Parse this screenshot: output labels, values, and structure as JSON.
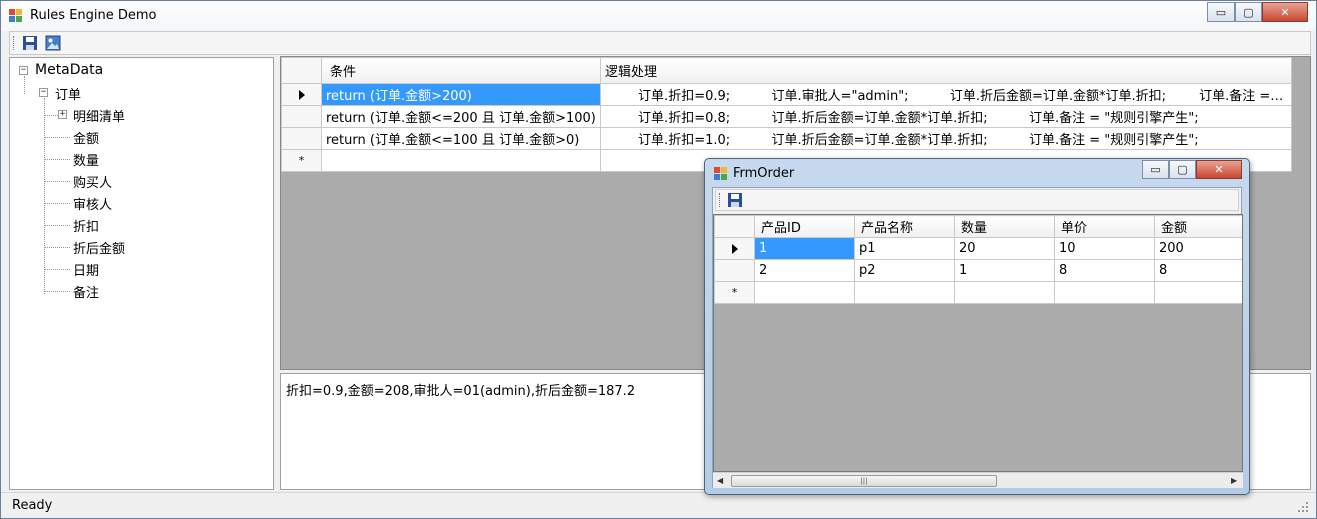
{
  "main": {
    "title": "Rules Engine Demo",
    "status": "Ready",
    "win_buttons": {
      "minimize": "▭",
      "maximize": "▢",
      "close": "✕"
    }
  },
  "toolbar": {
    "save_icon": "save-icon",
    "image_icon": "picture-icon"
  },
  "tree": {
    "root": "MetaData",
    "order": "订单",
    "detail": "明细清单",
    "fields": [
      "金额",
      "数量",
      "购买人",
      "审核人",
      "折扣",
      "折后金额",
      "日期",
      "备注"
    ],
    "expanded_symbol": "−",
    "collapsed_symbol": "+"
  },
  "rules_grid": {
    "headers": [
      "条件",
      "逻辑处理"
    ],
    "rows": [
      {
        "condition": "return (订单.金额>200)",
        "logic": "        订单.折扣=0.9;          订单.审批人=\"admin\";          订单.折后金额=订单.金额*订单.折扣;        订单.备注 = \"规则引擎产生\";"
      },
      {
        "condition": "return (订单.金额<=200 且 订单.金额>100)",
        "logic": "        订单.折扣=0.8;          订单.折后金额=订单.金额*订单.折扣;          订单.备注 = \"规则引擎产生\";"
      },
      {
        "condition": "return (订单.金额<=100 且 订单.金额>0)",
        "logic": "        订单.折扣=1.0;          订单.折后金额=订单.金额*订单.折扣;          订单.备注 = \"规则引擎产生\";"
      }
    ],
    "new_row_marker": "*"
  },
  "result": {
    "text": "折扣=0.9,金额=208,审批人=01(admin),折后金额=187.2"
  },
  "child": {
    "title": "FrmOrder",
    "headers": [
      "产品ID",
      "产品名称",
      "数量",
      "单价",
      "金额"
    ],
    "rows": [
      [
        "1",
        "p1",
        "20",
        "10",
        "200"
      ],
      [
        "2",
        "p2",
        "1",
        "8",
        "8"
      ]
    ],
    "new_row_marker": "*",
    "scroll_thumb": "|||",
    "scroll_left": "◀",
    "scroll_right": "▶"
  }
}
